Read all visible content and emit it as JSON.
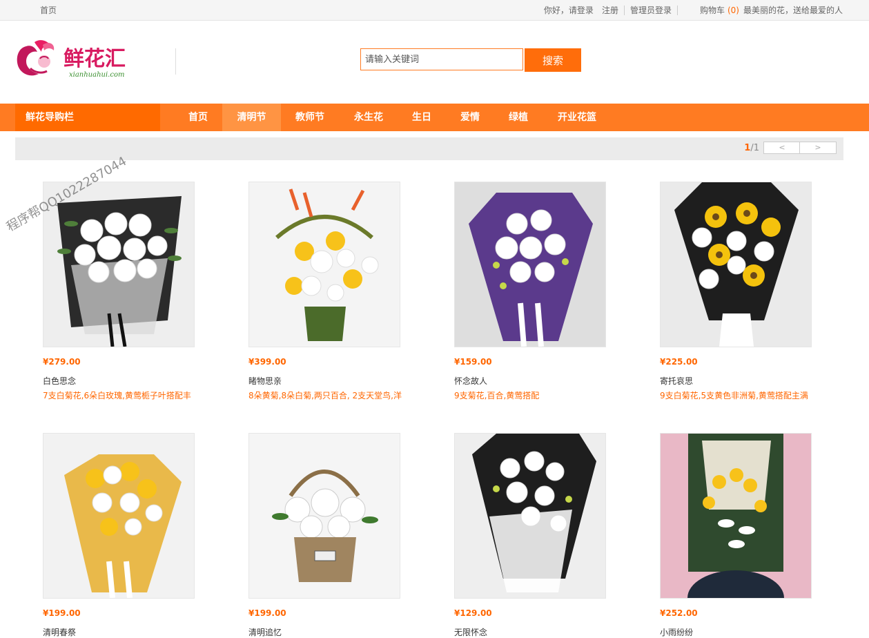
{
  "topbar": {
    "home": "首页",
    "greeting": "你好，请登录",
    "register": "注册",
    "admin_login": "管理员登录",
    "cart_label": "购物车",
    "cart_count": "(0)",
    "slogan": "最美丽的花，送给最爱的人"
  },
  "logo": {
    "text": "鲜花汇",
    "sub": "xianhuahui.com"
  },
  "search": {
    "placeholder": "请输入关键词",
    "button": "搜索"
  },
  "nav": {
    "category": "鲜花导购栏",
    "items": [
      "首页",
      "清明节",
      "教师节",
      "永生花",
      "生日",
      "爱情",
      "绿植",
      "开业花篮"
    ],
    "active": "清明节"
  },
  "pager": {
    "current": "1",
    "total": "/1",
    "prev": "<",
    "next": ">"
  },
  "products": [
    {
      "price": "¥279.00",
      "name": "白色思念",
      "desc": "7支白菊花,6朵白玫瑰,黄莺栀子叶搭配丰"
    },
    {
      "price": "¥399.00",
      "name": "睹物思亲",
      "desc": "8朵黄菊,8朵白菊,两只百合, 2支天堂鸟,洋"
    },
    {
      "price": "¥159.00",
      "name": "怀念故人",
      "desc": "9支菊花,百合,黄莺搭配"
    },
    {
      "price": "¥225.00",
      "name": "寄托哀思",
      "desc": "9支白菊花,5支黄色非洲菊,黄莺搭配主满"
    },
    {
      "price": "¥199.00",
      "name": "清明春祭",
      "desc": ""
    },
    {
      "price": "¥199.00",
      "name": "清明追忆",
      "desc": ""
    },
    {
      "price": "¥129.00",
      "name": "无限怀念",
      "desc": ""
    },
    {
      "price": "¥252.00",
      "name": "小雨纷纷",
      "desc": ""
    }
  ],
  "watermark": "程序帮QQ1022287044",
  "colors": {
    "accent": "#ff7b22",
    "price": "#ff6600",
    "nav_active": "#ff9443"
  }
}
